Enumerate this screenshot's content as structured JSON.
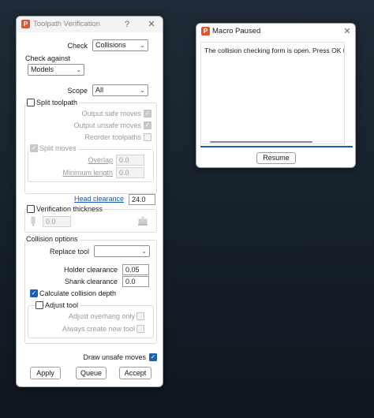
{
  "toolpath_dialog": {
    "title": "Toolpath Verification",
    "help_label": "?",
    "close_label": "✕",
    "check": {
      "label": "Check",
      "value": "Collisions"
    },
    "check_against": {
      "label": "Check against",
      "value": "Models"
    },
    "scope": {
      "label": "Scope",
      "value": "All"
    },
    "split_toolpath": {
      "label": "Split toolpath",
      "checked": false
    },
    "output_safe": {
      "label": "Output safe moves",
      "checked": true
    },
    "output_unsafe": {
      "label": "Output unsafe moves",
      "checked": true
    },
    "reorder_toolpaths": {
      "label": "Reorder toolpaths",
      "checked": false
    },
    "split_moves": {
      "label": "Split moves",
      "checked": true
    },
    "overlap": {
      "label": "Overlap",
      "value": "0.0"
    },
    "minimum_length": {
      "label": "Minimum length",
      "value": "0.0"
    },
    "head_clearance": {
      "label": "Head clearance",
      "value": "24.0"
    },
    "verification_thickness": {
      "label": "Verification thickness",
      "value": "0.0",
      "checked": false
    },
    "collision_options": {
      "title": "Collision options",
      "replace_tool": {
        "label": "Replace tool",
        "value": ""
      },
      "holder_clearance": {
        "label": "Holder clearance",
        "value": "0.05"
      },
      "shank_clearance": {
        "label": "Shank clearance",
        "value": "0.0"
      },
      "calculate_depth": {
        "label": "Calculate collision depth",
        "checked": true
      },
      "adjust_tool": {
        "label": "Adjust tool",
        "checked": false
      },
      "adjust_overhang_only": {
        "label": "Adjust overhang only",
        "checked": false
      },
      "always_create_new_tool": {
        "label": "Always create new tool",
        "checked": false
      }
    },
    "draw_unsafe_moves": {
      "label": "Draw unsafe moves",
      "checked": true
    },
    "buttons": {
      "apply": "Apply",
      "queue": "Queue",
      "accept": "Accept"
    }
  },
  "macro_dialog": {
    "title": "Macro Paused",
    "close_label": "✕",
    "message": "The collision checking form is open. Press OK to",
    "resume": "Resume"
  },
  "colors": {
    "accent": "#1a5fb4",
    "link": "#1a57b8",
    "app_icon": "#e0572a"
  }
}
